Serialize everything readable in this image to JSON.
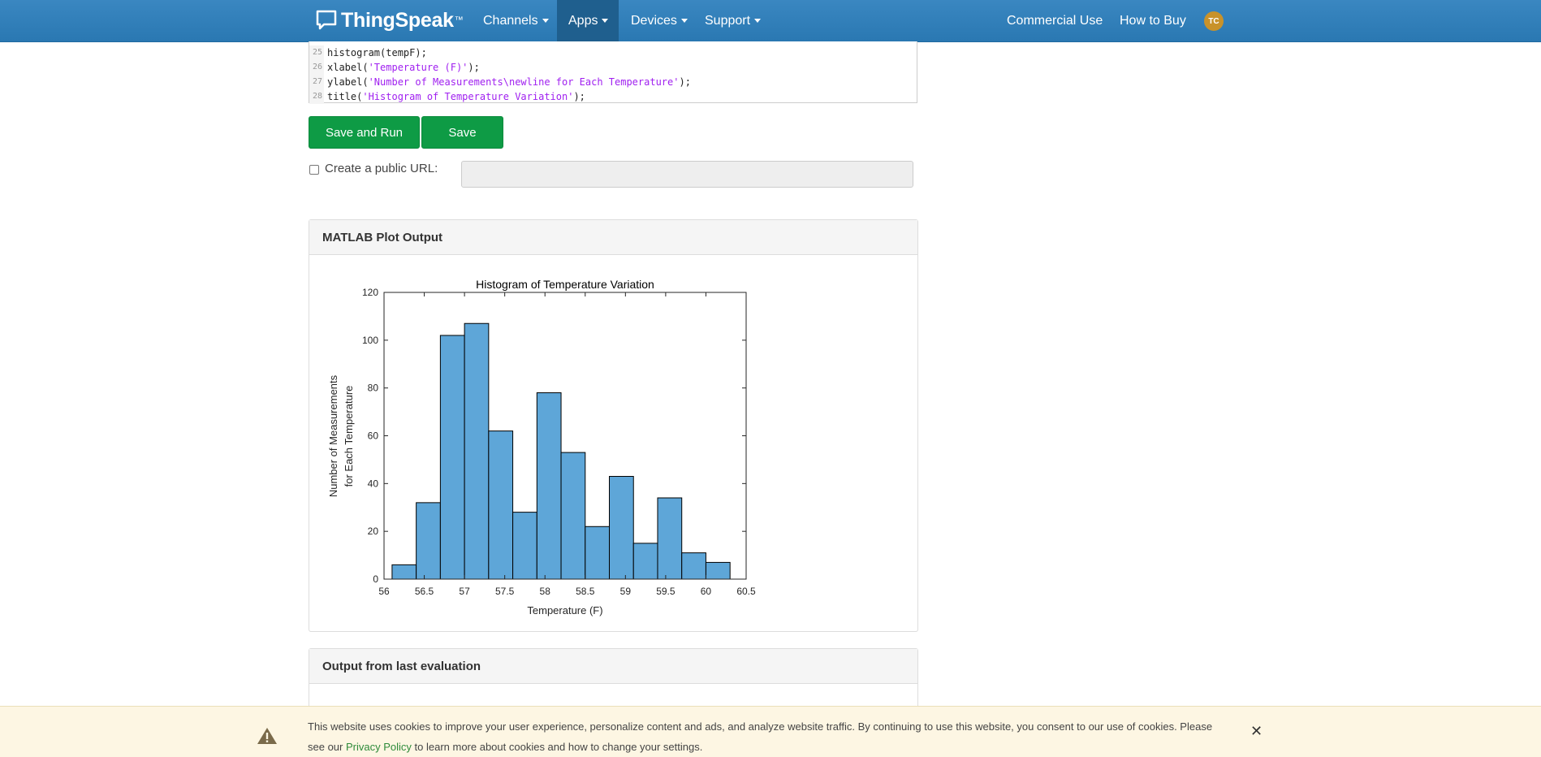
{
  "nav": {
    "brand": "ThingSpeak",
    "brand_tm": "™",
    "items": [
      "Channels",
      "Apps",
      "Devices",
      "Support"
    ],
    "right_items": [
      "Commercial Use",
      "How to Buy"
    ],
    "avatar_initials": "TC"
  },
  "editor": {
    "lines": [
      {
        "num": "25",
        "pre": "histogram(tempF);",
        "str": "",
        "post": ""
      },
      {
        "num": "26",
        "pre": "xlabel(",
        "str": "'Temperature (F)'",
        "post": ");"
      },
      {
        "num": "27",
        "pre": "ylabel(",
        "str": "'Number of Measurements\\newline for Each Temperature'",
        "post": ");"
      },
      {
        "num": "28",
        "pre": "title(",
        "str": "'Histogram of Temperature Variation'",
        "post": ");"
      }
    ]
  },
  "buttons": {
    "save_run": "Save and Run",
    "save": "Save"
  },
  "public_url": {
    "label": "Create a public URL:",
    "value": ""
  },
  "plot_panel": {
    "title": "MATLAB Plot Output"
  },
  "output_panel": {
    "title": "Output from last evaluation"
  },
  "chart_data": {
    "type": "bar",
    "title": "Histogram of Temperature Variation",
    "xlabel": "Temperature (F)",
    "ylabel_lines": [
      "Number of Measurements",
      "for Each Temperature"
    ],
    "xlim": [
      56,
      60.5
    ],
    "ylim": [
      0,
      120
    ],
    "xticks": [
      "56",
      "56.5",
      "57",
      "57.5",
      "58",
      "58.5",
      "59",
      "59.5",
      "60",
      "60.5"
    ],
    "yticks": [
      "0",
      "20",
      "40",
      "60",
      "80",
      "100",
      "120"
    ],
    "bin_edges": [
      56.1,
      56.4,
      56.7,
      57.0,
      57.3,
      57.6,
      57.9,
      58.2,
      58.5,
      58.8,
      59.1,
      59.4,
      59.7,
      60.0,
      60.3
    ],
    "values": [
      6,
      32,
      102,
      107,
      62,
      28,
      78,
      53,
      22,
      43,
      15,
      34,
      11,
      7
    ],
    "bar_color": "#5ea6d8",
    "grid": false
  },
  "cookie": {
    "text": "This website uses cookies to improve your user experience, personalize content and ads, and analyze website traffic. By continuing to use this website, you consent to our use of cookies. Please see our ",
    "link": "Privacy Policy",
    "text_after": " to learn more about cookies and how to change your settings."
  },
  "colors": {
    "navbar": "#2a78b2",
    "button_green": "#0e9b45",
    "cookie_bg": "#fdf6e3"
  }
}
